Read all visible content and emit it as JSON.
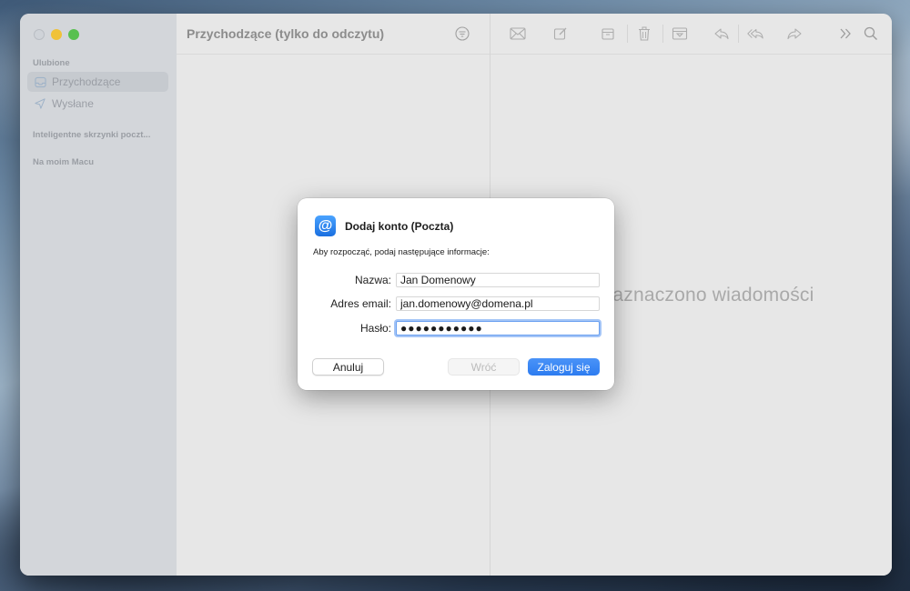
{
  "sidebar": {
    "favorites_label": "Ulubione",
    "items": [
      {
        "label": "Przychodzące",
        "icon": "inbox-icon",
        "selected": true
      },
      {
        "label": "Wysłane",
        "icon": "paperplane-icon",
        "selected": false
      }
    ],
    "smart_mailboxes_label": "Inteligentne skrzynki poczt...",
    "on_my_mac_label": "Na moim Macu"
  },
  "message_list": {
    "title": "Przychodzące (tylko do odczytu)"
  },
  "viewer": {
    "empty_text": "Nie zaznaczono wiadomości"
  },
  "dialog": {
    "title": "Dodaj konto (Poczta)",
    "subtitle": "Aby rozpocząć, podaj następujące informacje:",
    "fields": {
      "name_label": "Nazwa:",
      "name_value": "Jan Domenowy",
      "email_label": "Adres email:",
      "email_value": "jan.domenowy@domena.pl",
      "password_label": "Hasło:",
      "password_value": "●●●●●●●●●●●"
    },
    "buttons": {
      "cancel": "Anuluj",
      "back": "Wróć",
      "login": "Zaloguj się"
    }
  },
  "colors": {
    "accent": "#2d7cf0",
    "traffic_min": "#f0c238",
    "traffic_max": "#58c04f"
  }
}
